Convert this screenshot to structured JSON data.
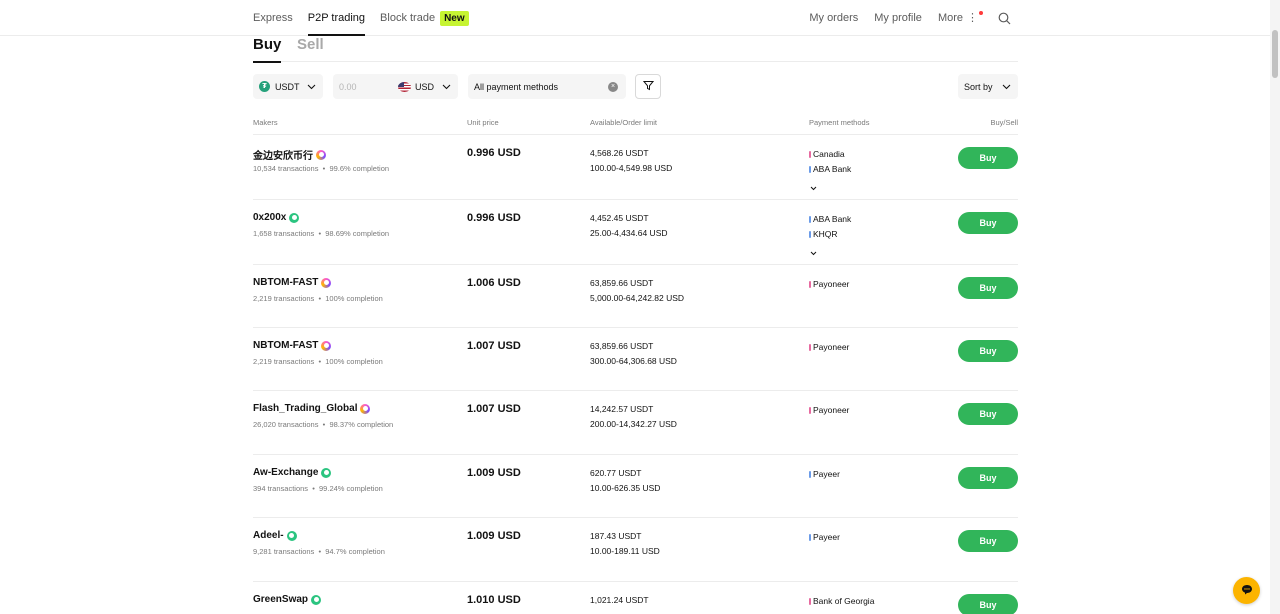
{
  "nav": {
    "left": [
      {
        "label": "Express",
        "active": false
      },
      {
        "label": "P2P trading",
        "active": true
      },
      {
        "label": "Block trade",
        "active": false
      }
    ],
    "new_badge": "New",
    "right": [
      {
        "label": "My orders"
      },
      {
        "label": "My profile"
      },
      {
        "label": "More"
      }
    ]
  },
  "tabs": {
    "buy": "Buy",
    "sell": "Sell"
  },
  "filters": {
    "coin": "USDT",
    "amount_placeholder": "0.00",
    "currency": "USD",
    "payment": "All payment methods",
    "sort": "Sort by"
  },
  "table": {
    "headers": {
      "makers": "Makers",
      "price": "Unit price",
      "available": "Available/Order limit",
      "payment": "Payment methods",
      "action": "Buy/Sell"
    },
    "rows": [
      {
        "name": "金边安欣币行",
        "badge": "purple",
        "transactions": "10,534 transactions",
        "completion": "99.6% completion",
        "price": "0.996 USD",
        "available": "4,568.26 USDT",
        "limit": "100.00-4,549.98 USD",
        "payments": [
          "Canadia",
          "ABA Bank"
        ],
        "more": true,
        "action": "Buy"
      },
      {
        "name": "0x200x",
        "badge": "green",
        "transactions": "1,658 transactions",
        "completion": "98.69% completion",
        "price": "0.996 USD",
        "available": "4,452.45 USDT",
        "limit": "25.00-4,434.64 USD",
        "payments": [
          "ABA Bank",
          "KHQR"
        ],
        "more": true,
        "action": "Buy"
      },
      {
        "name": "NBTOM-FAST",
        "badge": "purple",
        "transactions": "2,219 transactions",
        "completion": "100% completion",
        "price": "1.006 USD",
        "available": "63,859.66 USDT",
        "limit": "5,000.00-64,242.82 USD",
        "payments": [
          "Payoneer"
        ],
        "more": false,
        "action": "Buy"
      },
      {
        "name": "NBTOM-FAST",
        "badge": "purple",
        "transactions": "2,219 transactions",
        "completion": "100% completion",
        "price": "1.007 USD",
        "available": "63,859.66 USDT",
        "limit": "300.00-64,306.68 USD",
        "payments": [
          "Payoneer"
        ],
        "more": false,
        "action": "Buy"
      },
      {
        "name": "Flash_Trading_Global",
        "badge": "purple",
        "transactions": "26,020 transactions",
        "completion": "98.37% completion",
        "price": "1.007 USD",
        "available": "14,242.57 USDT",
        "limit": "200.00-14,342.27 USD",
        "payments": [
          "Payoneer"
        ],
        "more": false,
        "action": "Buy"
      },
      {
        "name": "Aw-Exchange",
        "badge": "green",
        "transactions": "394 transactions",
        "completion": "99.24% completion",
        "price": "1.009 USD",
        "available": "620.77 USDT",
        "limit": "10.00-626.35 USD",
        "payments": [
          "Payeer"
        ],
        "more": false,
        "action": "Buy"
      },
      {
        "name": "Adeel-",
        "badge": "green",
        "transactions": "9,281 transactions",
        "completion": "94.7% completion",
        "price": "1.009 USD",
        "available": "187.43 USDT",
        "limit": "10.00-189.11 USD",
        "payments": [
          "Payeer"
        ],
        "more": false,
        "action": "Buy"
      },
      {
        "name": "GreenSwap",
        "badge": "green",
        "transactions": "",
        "completion": "",
        "price": "1.010 USD",
        "available": "1,021.24 USDT",
        "limit": "",
        "payments": [
          "Bank of Georgia"
        ],
        "more": false,
        "action": "Buy"
      }
    ]
  },
  "colors": {
    "accent_buy": "#31b55a",
    "new_badge": "#c6f432",
    "chat": "#fcb400"
  },
  "icons": [
    "search-icon",
    "chevron-down-icon",
    "filter-icon",
    "clear-icon",
    "chat-icon",
    "usdt-coin-icon",
    "us-flag-icon",
    "verified-badge-icon"
  ]
}
